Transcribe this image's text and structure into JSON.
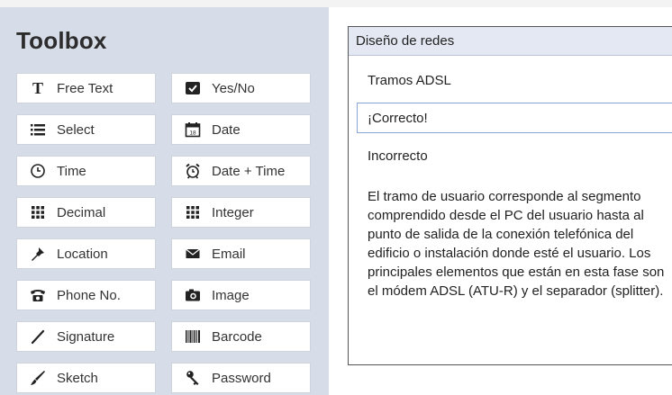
{
  "toolbox": {
    "title": "Toolbox",
    "items": [
      {
        "label": "Free Text",
        "icon": "text-t-icon"
      },
      {
        "label": "Yes/No",
        "icon": "checkbox-icon"
      },
      {
        "label": "Select",
        "icon": "list-icon"
      },
      {
        "label": "Date",
        "icon": "calendar-icon"
      },
      {
        "label": "Time",
        "icon": "clock-icon"
      },
      {
        "label": "Date + Time",
        "icon": "alarm-clock-icon"
      },
      {
        "label": "Decimal",
        "icon": "grid-icon"
      },
      {
        "label": "Integer",
        "icon": "grid-icon"
      },
      {
        "label": "Location",
        "icon": "pin-icon"
      },
      {
        "label": "Email",
        "icon": "envelope-icon"
      },
      {
        "label": "Phone No.",
        "icon": "phone-icon"
      },
      {
        "label": "Image",
        "icon": "camera-icon"
      },
      {
        "label": "Signature",
        "icon": "pen-line-icon"
      },
      {
        "label": "Barcode",
        "icon": "barcode-icon"
      },
      {
        "label": "Sketch",
        "icon": "brush-icon"
      },
      {
        "label": "Password",
        "icon": "key-icon"
      }
    ]
  },
  "question": {
    "header": "Diseño de redes",
    "options": [
      "Tramos ADSL",
      "¡Correcto!",
      "Incorrecto"
    ],
    "selected_option": "¡Correcto!",
    "description": "El tramo de usuario corresponde al segmento comprendido desde el PC del usuario hasta al punto de salida de la conexión telefónica del edificio o instalación donde esté el usuario. Los principales elementos que están en esta fase son el módem ADSL (ATU-R) y el separador (splitter)."
  },
  "colors": {
    "toolbox_bg": "#d7dde8",
    "header_bg": "#e3e8f2",
    "selected_border": "#8aa4d6"
  }
}
